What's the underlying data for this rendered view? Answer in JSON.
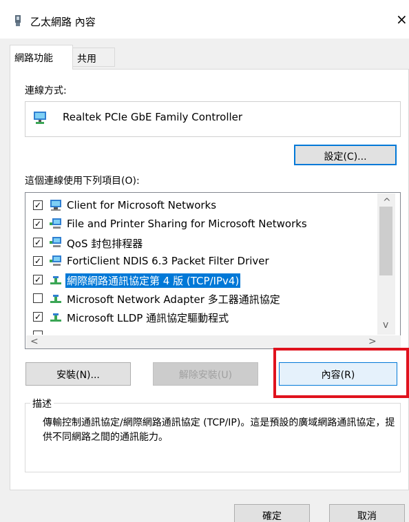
{
  "window": {
    "title": "乙太網路 內容",
    "close_glyph": "×"
  },
  "tabs": [
    {
      "label": "網路功能",
      "active": true
    },
    {
      "label": "共用",
      "active": false
    }
  ],
  "connection": {
    "label": "連線方式:",
    "adapter": "Realtek PCIe GbE Family Controller",
    "config_button": "設定(C)..."
  },
  "items": {
    "label": "這個連線使用下列項目(O):",
    "list": [
      {
        "label": "Client for Microsoft Networks",
        "checked": true,
        "icon": "network-client-icon"
      },
      {
        "label": "File and Printer Sharing for Microsoft Networks",
        "checked": true,
        "icon": "network-service-icon"
      },
      {
        "label": "QoS 封包排程器",
        "checked": true,
        "icon": "network-service-icon"
      },
      {
        "label": "FortiClient NDIS 6.3 Packet Filter Driver",
        "checked": true,
        "icon": "network-service-icon"
      },
      {
        "label": "網際網路通訊協定第 4 版 (TCP/IPv4)",
        "checked": true,
        "icon": "protocol-icon",
        "selected": true
      },
      {
        "label": "Microsoft Network Adapter 多工器通訊協定",
        "checked": false,
        "icon": "protocol-icon"
      },
      {
        "label": "Microsoft LLDP 通訊協定驅動程式",
        "checked": true,
        "icon": "protocol-icon"
      }
    ],
    "scroll_up": "^",
    "scroll_down": "v",
    "scroll_left": "<",
    "scroll_right": ">"
  },
  "buttons": {
    "install": "安裝(N)...",
    "uninstall": "解除安裝(U)",
    "properties": "內容(R)",
    "ok": "確定",
    "cancel": "取消"
  },
  "description": {
    "legend": "描述",
    "text": "傳輸控制通訊協定/網際網路通訊協定 (TCP/IP)。這是預設的廣域網路通訊協定，提供不同網路之間的通訊能力。"
  },
  "colors": {
    "selection": "#0078d7",
    "highlight_box": "#e0121d"
  }
}
